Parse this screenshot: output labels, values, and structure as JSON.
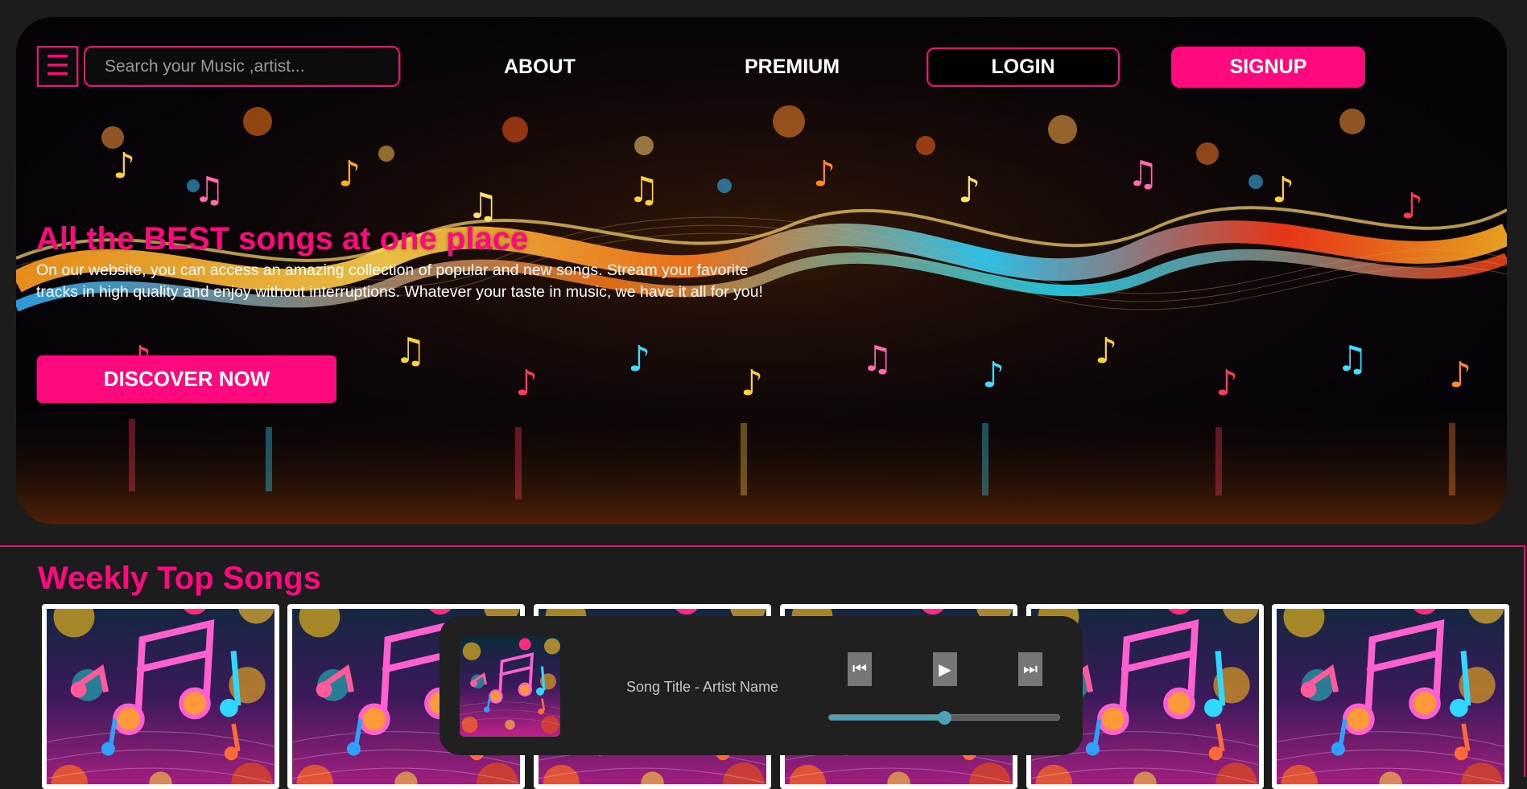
{
  "header": {
    "menu_icon": "☰",
    "search_placeholder": "Search your Music ,artist...",
    "nav": {
      "about": "ABOUT",
      "premium": "PREMIUM"
    },
    "login": "LOGIN",
    "signup": "SIGNUP"
  },
  "hero": {
    "headline": "All the BEST songs at one place",
    "description": "On our website, you can access an amazing collection of popular and new songs. Stream your favorite tracks in high quality and enjoy without interruptions. Whatever your taste in music, we have it all for you!",
    "cta": "DISCOVER NOW"
  },
  "weekly": {
    "title": "Weekly Top Songs",
    "cards": [
      {
        "art": "music-notes-art"
      },
      {
        "art": "music-notes-art"
      },
      {
        "art": "music-notes-art"
      },
      {
        "art": "music-notes-art"
      },
      {
        "art": "music-notes-art"
      },
      {
        "art": "music-notes-art"
      }
    ]
  },
  "player": {
    "song_text": "Song Title - Artist Name",
    "controls": {
      "prev_icon": "⏮",
      "play_icon": "▶",
      "next_icon": "⏭"
    },
    "progress": 0.5
  },
  "colors": {
    "accent": "#ff0a7e",
    "page_bg": "#1c1c1c",
    "player_bg": "#202020",
    "progress": "#4aa2b4"
  }
}
